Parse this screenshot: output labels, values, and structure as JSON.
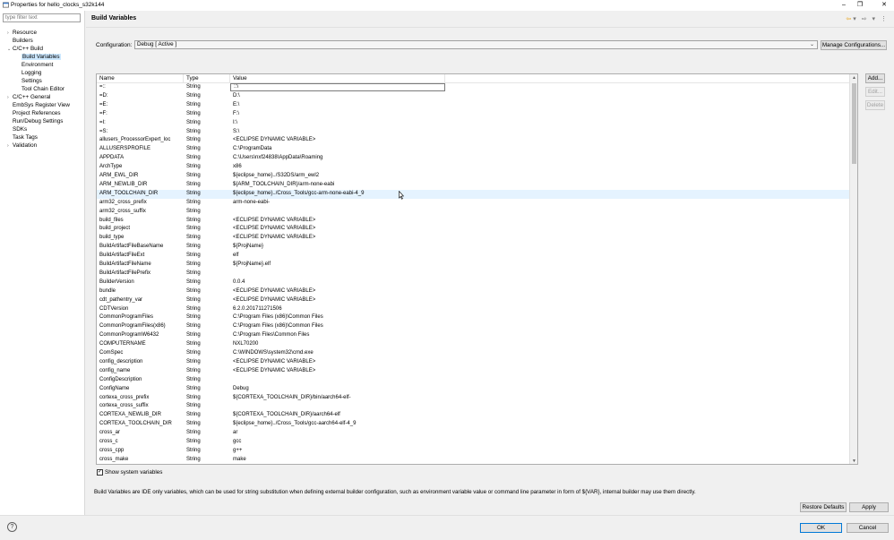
{
  "window": {
    "title": "Properties for hello_clocks_s32k144",
    "minimize": "–",
    "restore": "❐",
    "close": "✕"
  },
  "filter": {
    "placeholder": "type filter text"
  },
  "tree": [
    {
      "label": "Resource",
      "arrow": "›"
    },
    {
      "label": "Builders",
      "arrow": ""
    },
    {
      "label": "C/C++ Build",
      "arrow": "⌄"
    },
    {
      "label": "Build Variables",
      "arrow": "",
      "selected": true
    },
    {
      "label": "Environment",
      "arrow": ""
    },
    {
      "label": "Logging",
      "arrow": ""
    },
    {
      "label": "Settings",
      "arrow": ""
    },
    {
      "label": "Tool Chain Editor",
      "arrow": ""
    },
    {
      "label": "C/C++ General",
      "arrow": "›"
    },
    {
      "label": "EmbSys Register View",
      "arrow": ""
    },
    {
      "label": "Project References",
      "arrow": ""
    },
    {
      "label": "Run/Debug Settings",
      "arrow": ""
    },
    {
      "label": "SDKs",
      "arrow": ""
    },
    {
      "label": "Task Tags",
      "arrow": ""
    },
    {
      "label": "Validation",
      "arrow": "›"
    }
  ],
  "page": {
    "title": "Build Variables",
    "nav_icons": "⇦ ▾ ⇨ ▾ ⋮"
  },
  "config": {
    "label": "Configuration:",
    "value": "Debug  [ Active ]",
    "manage_button": "Manage Configurations..."
  },
  "table": {
    "columns": [
      "Name",
      "Type",
      "Value"
    ],
    "rows": [
      [
        "=::",
        "String",
        "::\\"
      ],
      [
        "=D:",
        "String",
        "D:\\"
      ],
      [
        "=E:",
        "String",
        "E:\\"
      ],
      [
        "=F:",
        "String",
        "F:\\"
      ],
      [
        "=I:",
        "String",
        "I:\\"
      ],
      [
        "=S:",
        "String",
        "S:\\"
      ],
      [
        "allusers_ProcessorExpert_loc",
        "String",
        "<ECLIPSE DYNAMIC VARIABLE>"
      ],
      [
        "ALLUSERSPROFILE",
        "String",
        "C:\\ProgramData"
      ],
      [
        "APPDATA",
        "String",
        "C:\\Users\\nxf24838\\AppData\\Roaming"
      ],
      [
        "ArchType",
        "String",
        "x86"
      ],
      [
        "ARM_EWL_DIR",
        "String",
        "${eclipse_home}../S32DS/arm_ewl2"
      ],
      [
        "ARM_NEWLIB_DIR",
        "String",
        "${ARM_TOOLCHAIN_DIR}/arm-none-eabi"
      ],
      [
        "ARM_TOOLCHAIN_DIR",
        "String",
        "${eclipse_home}../Cross_Tools/gcc-arm-none-eabi-4_9"
      ],
      [
        "arm32_cross_prefix",
        "String",
        "arm-none-eabi-"
      ],
      [
        "arm32_cross_suffix",
        "String",
        ""
      ],
      [
        "build_files",
        "String",
        "<ECLIPSE DYNAMIC VARIABLE>"
      ],
      [
        "build_project",
        "String",
        "<ECLIPSE DYNAMIC VARIABLE>"
      ],
      [
        "build_type",
        "String",
        "<ECLIPSE DYNAMIC VARIABLE>"
      ],
      [
        "BuildArtifactFileBaseName",
        "String",
        "${ProjName}"
      ],
      [
        "BuildArtifactFileExt",
        "String",
        "elf"
      ],
      [
        "BuildArtifactFileName",
        "String",
        "${ProjName}.elf"
      ],
      [
        "BuildArtifactFilePrefix",
        "String",
        ""
      ],
      [
        "BuilderVersion",
        "String",
        "0.0.4"
      ],
      [
        "bundle",
        "String",
        "<ECLIPSE DYNAMIC VARIABLE>"
      ],
      [
        "cdt_pathentry_var",
        "String",
        "<ECLIPSE DYNAMIC VARIABLE>"
      ],
      [
        "CDTVersion",
        "String",
        "6.2.0.201711271506"
      ],
      [
        "CommonProgramFiles",
        "String",
        "C:\\Program Files (x86)\\Common Files"
      ],
      [
        "CommonProgramFiles(x86)",
        "String",
        "C:\\Program Files (x86)\\Common Files"
      ],
      [
        "CommonProgramW6432",
        "String",
        "C:\\Program Files\\Common Files"
      ],
      [
        "COMPUTERNAME",
        "String",
        "NXL70200"
      ],
      [
        "ComSpec",
        "String",
        "C:\\WINDOWS\\system32\\cmd.exe"
      ],
      [
        "config_description",
        "String",
        "<ECLIPSE DYNAMIC VARIABLE>"
      ],
      [
        "config_name",
        "String",
        "<ECLIPSE DYNAMIC VARIABLE>"
      ],
      [
        "ConfigDescription",
        "String",
        ""
      ],
      [
        "ConfigName",
        "String",
        "Debug"
      ],
      [
        "cortexa_cross_prefix",
        "String",
        "${CORTEXA_TOOLCHAIN_DIR}/bin/aarch64-elf-"
      ],
      [
        "cortexa_cross_suffix",
        "String",
        ""
      ],
      [
        "CORTEXA_NEWLIB_DIR",
        "String",
        "${CORTEXA_TOOLCHAIN_DIR}/aarch64-elf"
      ],
      [
        "CORTEXA_TOOLCHAIN_DIR",
        "String",
        "${eclipse_home}../Cross_Tools/gcc-aarch64-elf-4_9"
      ],
      [
        "cross_ar",
        "String",
        "ar"
      ],
      [
        "cross_c",
        "String",
        "gcc"
      ],
      [
        "cross_cpp",
        "String",
        "g++"
      ],
      [
        "cross_make",
        "String",
        "make"
      ]
    ]
  },
  "side_buttons": {
    "add": "Add...",
    "edit": "Edit...",
    "delete": "Delete"
  },
  "show_system": {
    "label": "Show system variables",
    "check": "✓"
  },
  "description": "Build Variables are IDE only variables, which can be used for string substitution when defining external builder configuration, such as environment variable value or command line parameter in form of ${VAR}, internal builder may use them directly.",
  "footer": {
    "restore_defaults": "Restore Defaults",
    "apply": "Apply",
    "ok": "OK",
    "cancel": "Cancel",
    "help": "?"
  },
  "colors": {
    "selection": "#cce8ff",
    "hover_row": "#e5f3ff",
    "accent": "#0078d7"
  }
}
